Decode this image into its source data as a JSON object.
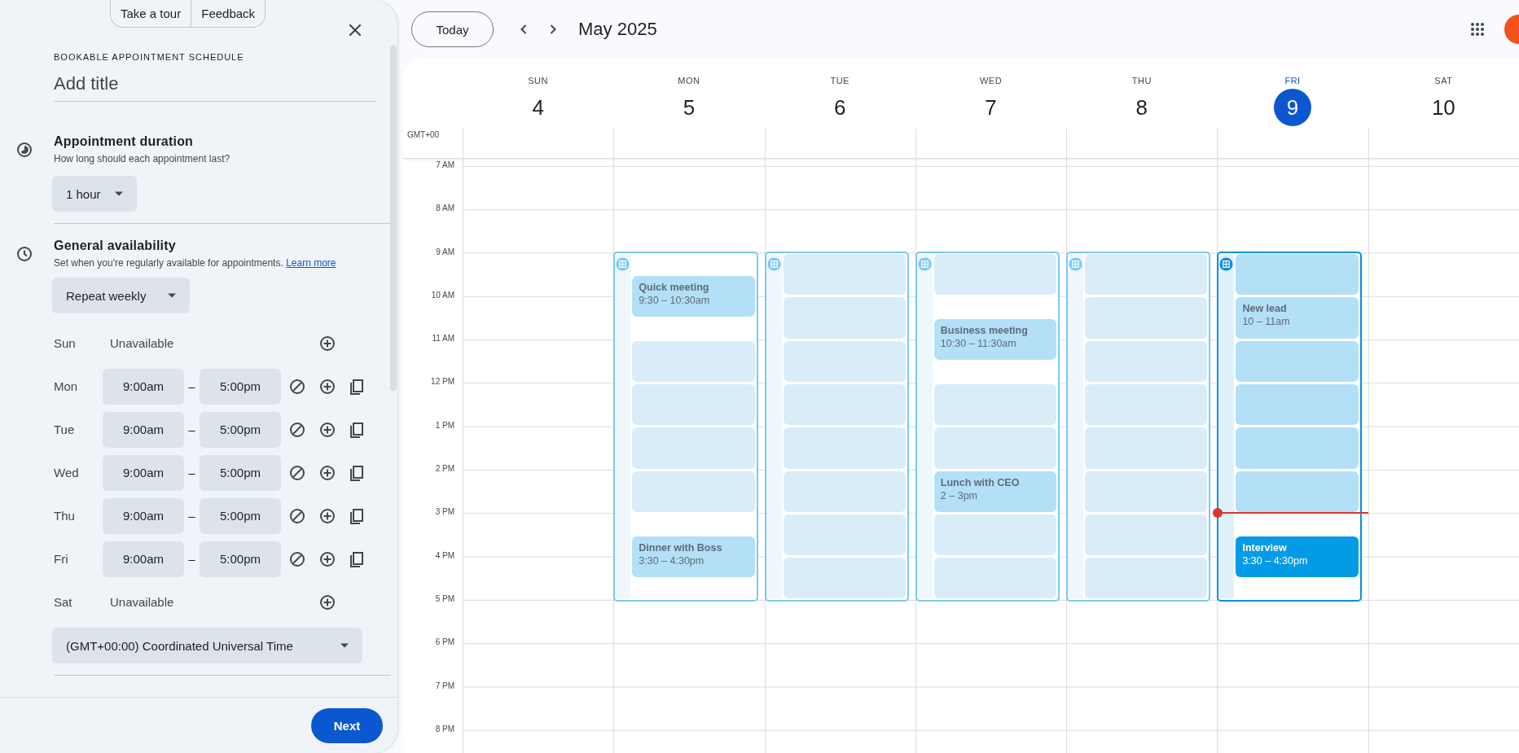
{
  "panel": {
    "top_buttons": [
      {
        "label": "Take a tour"
      },
      {
        "label": "Feedback"
      }
    ],
    "heading": "BOOKABLE APPOINTMENT SCHEDULE",
    "title_field": {
      "placeholder": "Add title"
    },
    "duration": {
      "title": "Appointment duration",
      "subtitle": "How long should each appointment last?",
      "value": "1 hour"
    },
    "availability": {
      "title": "General availability",
      "subtitle": "Set when you're regularly available for appointments.",
      "link": "Learn more",
      "repeat": "Repeat weekly",
      "days": [
        {
          "day": "Sun",
          "kind": "unavailable",
          "status": "Unavailable"
        },
        {
          "day": "Mon",
          "kind": "hours",
          "start": "9:00am",
          "separator": "–",
          "end": "5:00pm"
        },
        {
          "day": "Tue",
          "kind": "hours",
          "start": "9:00am",
          "separator": "–",
          "end": "5:00pm"
        },
        {
          "day": "Wed",
          "kind": "hours",
          "start": "9:00am",
          "separator": "–",
          "end": "5:00pm"
        },
        {
          "day": "Thu",
          "kind": "hours",
          "start": "9:00am",
          "separator": "–",
          "end": "5:00pm"
        },
        {
          "day": "Fri",
          "kind": "hours",
          "start": "9:00am",
          "separator": "–",
          "end": "5:00pm"
        },
        {
          "day": "Sat",
          "kind": "unavailable",
          "status": "Unavailable"
        }
      ],
      "timezone": "(GMT+00:00) Coordinated Universal Time"
    },
    "next_button": "Next"
  },
  "toolbar": {
    "today_button": "Today",
    "period": "May 2025"
  },
  "calendar": {
    "timezone_label": "GMT+00",
    "hours": [
      "7 AM",
      "8 AM",
      "9 AM",
      "10 AM",
      "11 AM",
      "12 PM",
      "1 PM",
      "2 PM",
      "3 PM",
      "4 PM",
      "5 PM",
      "6 PM",
      "7 PM",
      "8 PM"
    ],
    "days": [
      {
        "name": "SUN",
        "number": "4",
        "selected": false,
        "now": false
      },
      {
        "name": "MON",
        "number": "5",
        "selected": false,
        "now": false,
        "block": {
          "selected": false,
          "items": [
            {
              "kind": "gap"
            },
            {
              "kind": "event",
              "title": "Quick meeting",
              "time": "9:30 – 10:30am"
            },
            {
              "kind": "gap"
            },
            {
              "kind": "slot"
            },
            {
              "kind": "slot"
            },
            {
              "kind": "slot"
            },
            {
              "kind": "slot"
            },
            {
              "kind": "gap"
            },
            {
              "kind": "event",
              "title": "Dinner with Boss",
              "time": "3:30 – 4:30pm"
            },
            {
              "kind": "gap"
            }
          ]
        }
      },
      {
        "name": "TUE",
        "number": "6",
        "selected": false,
        "now": false,
        "block": {
          "selected": false,
          "items": [
            {
              "kind": "slot"
            },
            {
              "kind": "slot"
            },
            {
              "kind": "slot"
            },
            {
              "kind": "slot"
            },
            {
              "kind": "slot"
            },
            {
              "kind": "slot"
            },
            {
              "kind": "slot"
            },
            {
              "kind": "slot"
            }
          ]
        }
      },
      {
        "name": "WED",
        "number": "7",
        "selected": false,
        "now": false,
        "block": {
          "selected": false,
          "items": [
            {
              "kind": "slot"
            },
            {
              "kind": "gap"
            },
            {
              "kind": "event",
              "title": "Business meeting",
              "time": "10:30 – 11:30am"
            },
            {
              "kind": "gap"
            },
            {
              "kind": "slot"
            },
            {
              "kind": "slot"
            },
            {
              "kind": "event",
              "title": "Lunch with CEO",
              "time": "2 – 3pm"
            },
            {
              "kind": "slot"
            },
            {
              "kind": "slot"
            }
          ]
        }
      },
      {
        "name": "THU",
        "number": "8",
        "selected": false,
        "now": false,
        "block": {
          "selected": false,
          "items": [
            {
              "kind": "slot"
            },
            {
              "kind": "slot"
            },
            {
              "kind": "slot"
            },
            {
              "kind": "slot"
            },
            {
              "kind": "slot"
            },
            {
              "kind": "slot"
            },
            {
              "kind": "slot"
            },
            {
              "kind": "slot"
            }
          ]
        }
      },
      {
        "name": "FRI",
        "number": "9",
        "selected": true,
        "now": true,
        "block": {
          "selected": true,
          "items": [
            {
              "kind": "slot"
            },
            {
              "kind": "event",
              "title": "New lead",
              "time": "10 – 11am"
            },
            {
              "kind": "slot"
            },
            {
              "kind": "slot"
            },
            {
              "kind": "slot"
            },
            {
              "kind": "slot"
            },
            {
              "kind": "gap"
            },
            {
              "kind": "booking",
              "title": "Interview",
              "time": "3:30 – 4:30pm"
            },
            {
              "kind": "gap"
            }
          ]
        }
      },
      {
        "name": "SAT",
        "number": "10",
        "selected": false,
        "now": false
      }
    ]
  }
}
